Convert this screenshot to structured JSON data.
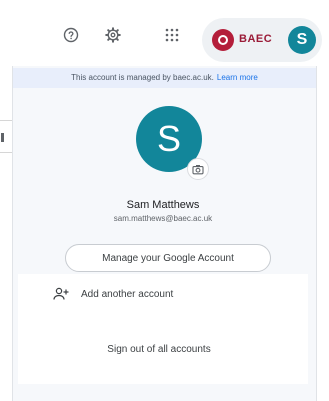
{
  "topbar": {
    "help_icon": "help-circle-icon",
    "settings_icon": "gear-icon",
    "apps_icon": "apps-grid-icon",
    "org_name": "BAEC",
    "avatar_initial": "S",
    "avatar_color": "#12869a",
    "brand_color": "#9a1b37"
  },
  "panel": {
    "managed_text": "This account is managed by baec.ac.uk.",
    "managed_link": "Learn more",
    "account": {
      "initial": "S",
      "name": "Sam Matthews",
      "email": "sam.matthews@baec.ac.uk",
      "camera_icon": "camera-icon",
      "manage_button": "Manage your Google Account"
    },
    "add_account": {
      "icon": "add-person-icon",
      "label": "Add another account"
    },
    "sign_out": "Sign out of all accounts"
  }
}
